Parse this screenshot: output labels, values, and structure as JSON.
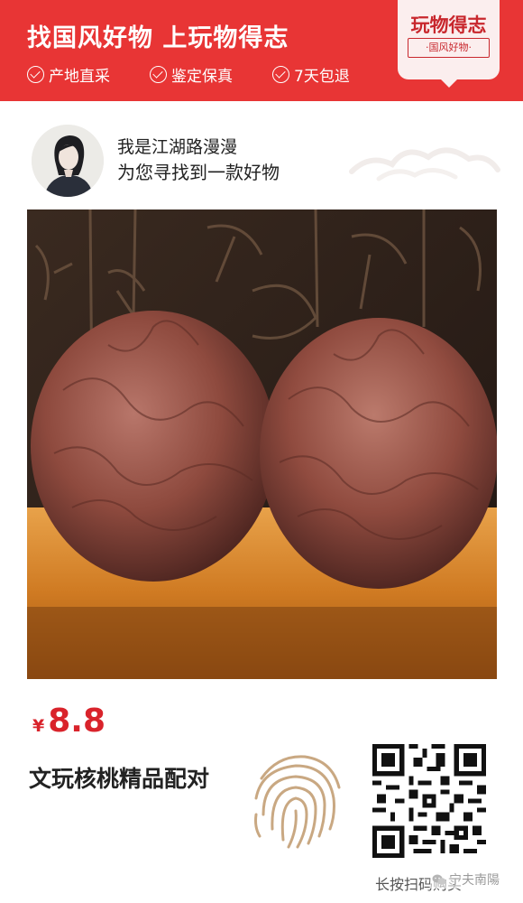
{
  "header": {
    "slogan": "找国风好物  上玩物得志",
    "features": [
      "产地直采",
      "鉴定保真",
      "7天包退"
    ],
    "background_color": "#e83535"
  },
  "badge": {
    "title": "玩物得志",
    "subtitle": "·国风好物·",
    "color": "#c8272d"
  },
  "curator": {
    "name": "我是江湖路漫漫",
    "tagline": "为您寻找到一款好物"
  },
  "product": {
    "currency": "¥",
    "price": "8.8",
    "name": "文玩核桃精品配对",
    "price_color": "#d9232b"
  },
  "footer": {
    "scan_hint": "长按扫码购买",
    "watermark": "宁夫南陽",
    "icons": [
      "fingerprint-icon",
      "qr-code",
      "wechat-icon"
    ]
  }
}
